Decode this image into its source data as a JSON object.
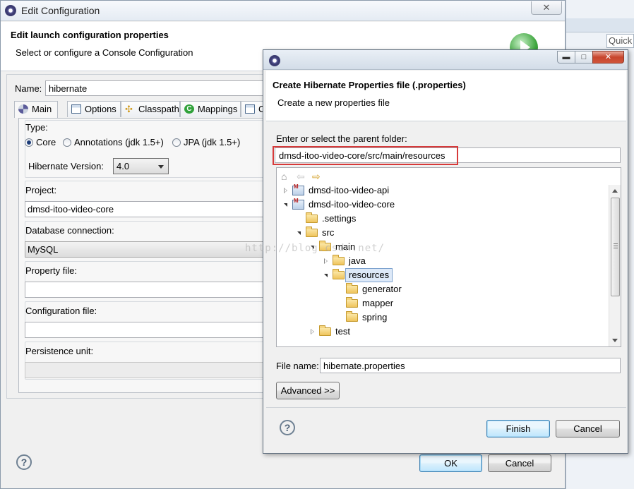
{
  "background_window": {
    "title": "Edit Configuration",
    "close_glyph": "✕",
    "heading": "Edit launch configuration properties",
    "subheading": "Select or configure a Console Configuration",
    "name_label": "Name:",
    "name_value": "hibernate",
    "tabs": [
      {
        "label": "Main",
        "icon": "main-icon",
        "active": true
      },
      {
        "label": "Options",
        "icon": "options-icon"
      },
      {
        "label": "Classpath",
        "icon": "classpath-icon"
      },
      {
        "label": "Mappings",
        "icon": "mappings-icon"
      },
      {
        "label": "Co",
        "icon": "configuration-icon"
      }
    ],
    "type_label": "Type:",
    "type_options": [
      "Core",
      "Annotations (jdk 1.5+)",
      "JPA (jdk 1.5+)"
    ],
    "type_selected": "Core",
    "hibernate_version_label": "Hibernate Version:",
    "hibernate_version_value": "4.0",
    "project_label": "Project:",
    "project_value": "dmsd-itoo-video-core",
    "db_connection_label": "Database connection:",
    "db_connection_value": "MySQL",
    "property_file_label": "Property file:",
    "property_file_value": "",
    "config_file_label": "Configuration file:",
    "config_file_value": "",
    "persistence_unit_label": "Persistence unit:",
    "persistence_unit_value": "",
    "help_glyph": "?",
    "ok_label": "OK",
    "cancel_label": "Cancel"
  },
  "behind_window": {
    "quick_access_text": "Quick"
  },
  "dialog": {
    "title": "",
    "min_glyph": "▬",
    "max_glyph": "□",
    "close_glyph": "✕",
    "heading": "Create Hibernate Properties file (.properties)",
    "subheading": "Create a new properties file",
    "folder_label": "Enter or select the parent folder:",
    "folder_value": "dmsd-itoo-video-core/src/main/resources",
    "tree_toolbar": {
      "home": "⌂",
      "back": "⇦",
      "forward": "⇨"
    },
    "tree": [
      {
        "label": "dmsd-itoo-video-api",
        "icon": "project-icon",
        "expander": "closed",
        "selected": false
      },
      {
        "label": "dmsd-itoo-video-core",
        "icon": "project-icon",
        "expander": "open",
        "selected": false
      },
      {
        "label": ".settings",
        "icon": "folder-icon",
        "expander": "none",
        "selected": false
      },
      {
        "label": "src",
        "icon": "folder-icon",
        "expander": "open",
        "selected": false
      },
      {
        "label": "main",
        "icon": "folder-icon",
        "expander": "open",
        "selected": false
      },
      {
        "label": "java",
        "icon": "folder-icon",
        "expander": "closed",
        "selected": false
      },
      {
        "label": "resources",
        "icon": "folder-icon",
        "expander": "open",
        "selected": true
      },
      {
        "label": "generator",
        "icon": "folder-icon",
        "expander": "none",
        "selected": false
      },
      {
        "label": "mapper",
        "icon": "folder-icon",
        "expander": "none",
        "selected": false
      },
      {
        "label": "spring",
        "icon": "folder-icon",
        "expander": "none",
        "selected": false
      },
      {
        "label": "test",
        "icon": "folder-icon",
        "expander": "closed",
        "selected": false
      }
    ],
    "file_name_label": "File name:",
    "file_name_value": "hibernate.properties",
    "advanced_label": "Advanced >>",
    "help_glyph": "?",
    "finish_label": "Finish",
    "cancel_label": "Cancel"
  },
  "watermark_text": "http://blog.csdn.net/",
  "colors": {
    "highlight_box": "#d73a3a",
    "selection_fill": "#dde9f8"
  }
}
